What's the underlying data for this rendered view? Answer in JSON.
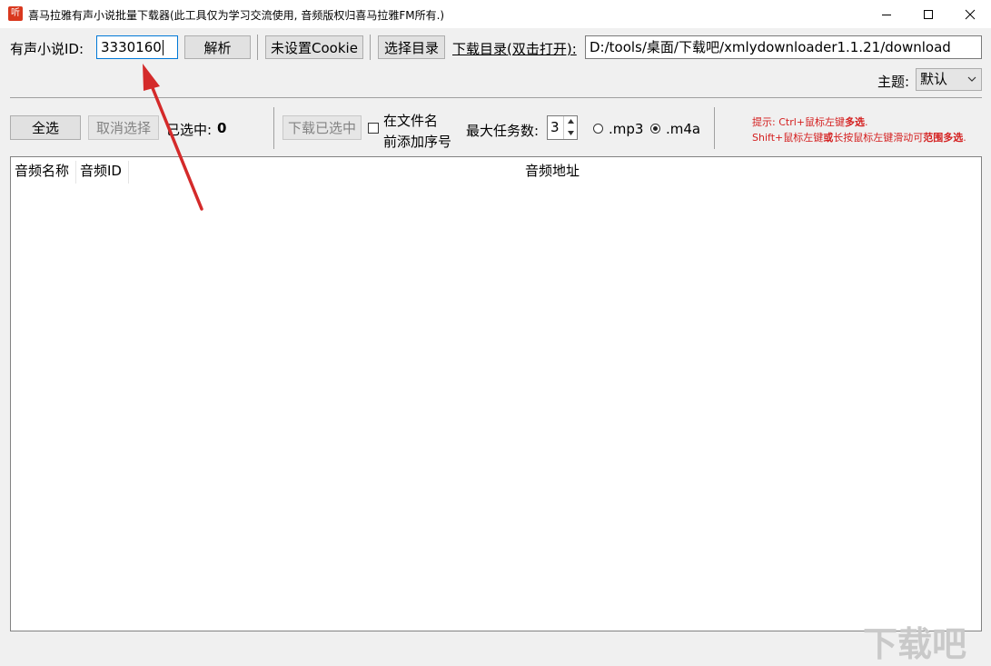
{
  "window": {
    "icon_glyph": "听",
    "title": "喜马拉雅有声小说批量下载器(此工具仅为学习交流使用, 音频版权归喜马拉雅FM所有.)",
    "controls": [
      "minimize-icon",
      "maximize-icon",
      "close-icon"
    ]
  },
  "toolbar": {
    "novel_id_label": "有声小说ID:",
    "novel_id_value": "3330160",
    "parse_label": "解析",
    "cookie_label": "未设置Cookie",
    "choose_dir_label": "选择目录",
    "download_dir_label": "下载目录(双击打开):",
    "download_dir_value": "D:/tools/桌面/下载吧/xmlydownloader1.1.21/download",
    "theme_label": "主题:",
    "theme_value": "默认"
  },
  "controls": {
    "select_all_label": "全选",
    "deselect_label": "取消选择",
    "selected_label": "已选中:",
    "selected_count": "0",
    "download_selected_label": "下载已选中",
    "prefix_line1": "在文件名",
    "prefix_line2": "前添加序号",
    "prefix_checked": false,
    "max_tasks_label": "最大任务数:",
    "max_tasks_value": "3",
    "format_mp3": ".mp3",
    "format_m4a": ".m4a",
    "format_selected": ".m4a",
    "hint_line1_prefix": "提示: Ctrl+鼠标左键",
    "hint_line1_bold": "多选",
    "hint_line1_end": ".",
    "hint_line2_prefix": "Shift+鼠标左键",
    "hint_line2_bold1": "或",
    "hint_line2_mid": "长按鼠标左键滑动可",
    "hint_line2_bold2": "范围多选",
    "hint_line2_end": "."
  },
  "table": {
    "columns": [
      "音频名称",
      "音频ID",
      "音频地址"
    ],
    "rows": []
  },
  "annotation": {
    "arrow_color": "#d42a2a"
  },
  "watermark": "下载吧"
}
